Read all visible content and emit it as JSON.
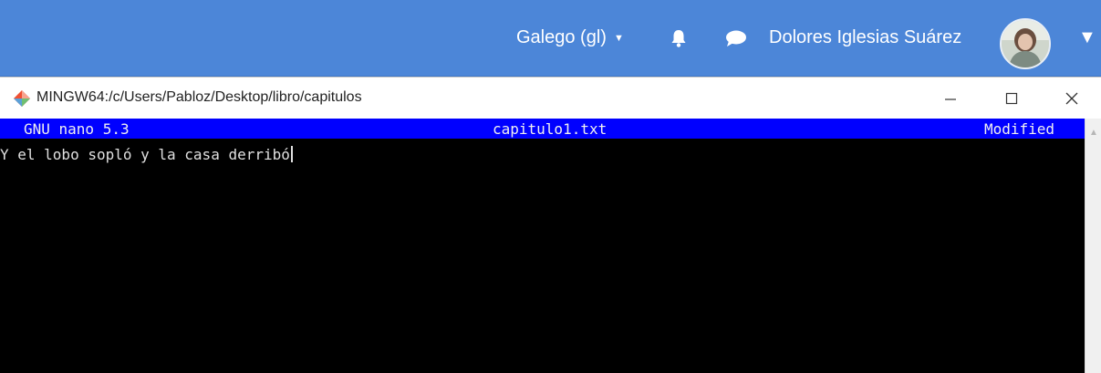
{
  "topbar": {
    "language": "Galego (gl)",
    "user_name": "Dolores Iglesias Suárez",
    "icons": {
      "language_caret": "caret-down-icon",
      "notifications": "bell-icon",
      "messages": "chat-bubble-icon",
      "user_menu": "caret-down-icon"
    },
    "accent_color": "#4c86d8"
  },
  "window": {
    "title": "MINGW64:/c/Users/Pabloz/Desktop/libro/capitulos",
    "buttons": {
      "minimize": "—",
      "maximize": "☐",
      "close": "✕"
    },
    "icon": "git-bash-icon"
  },
  "nano": {
    "version": "GNU nano 5.3",
    "filename": "capitulo1.txt",
    "status": "Modified",
    "header_color": "#0000ff",
    "lines": [
      "Y el lobo sopló y la casa derribó"
    ]
  }
}
